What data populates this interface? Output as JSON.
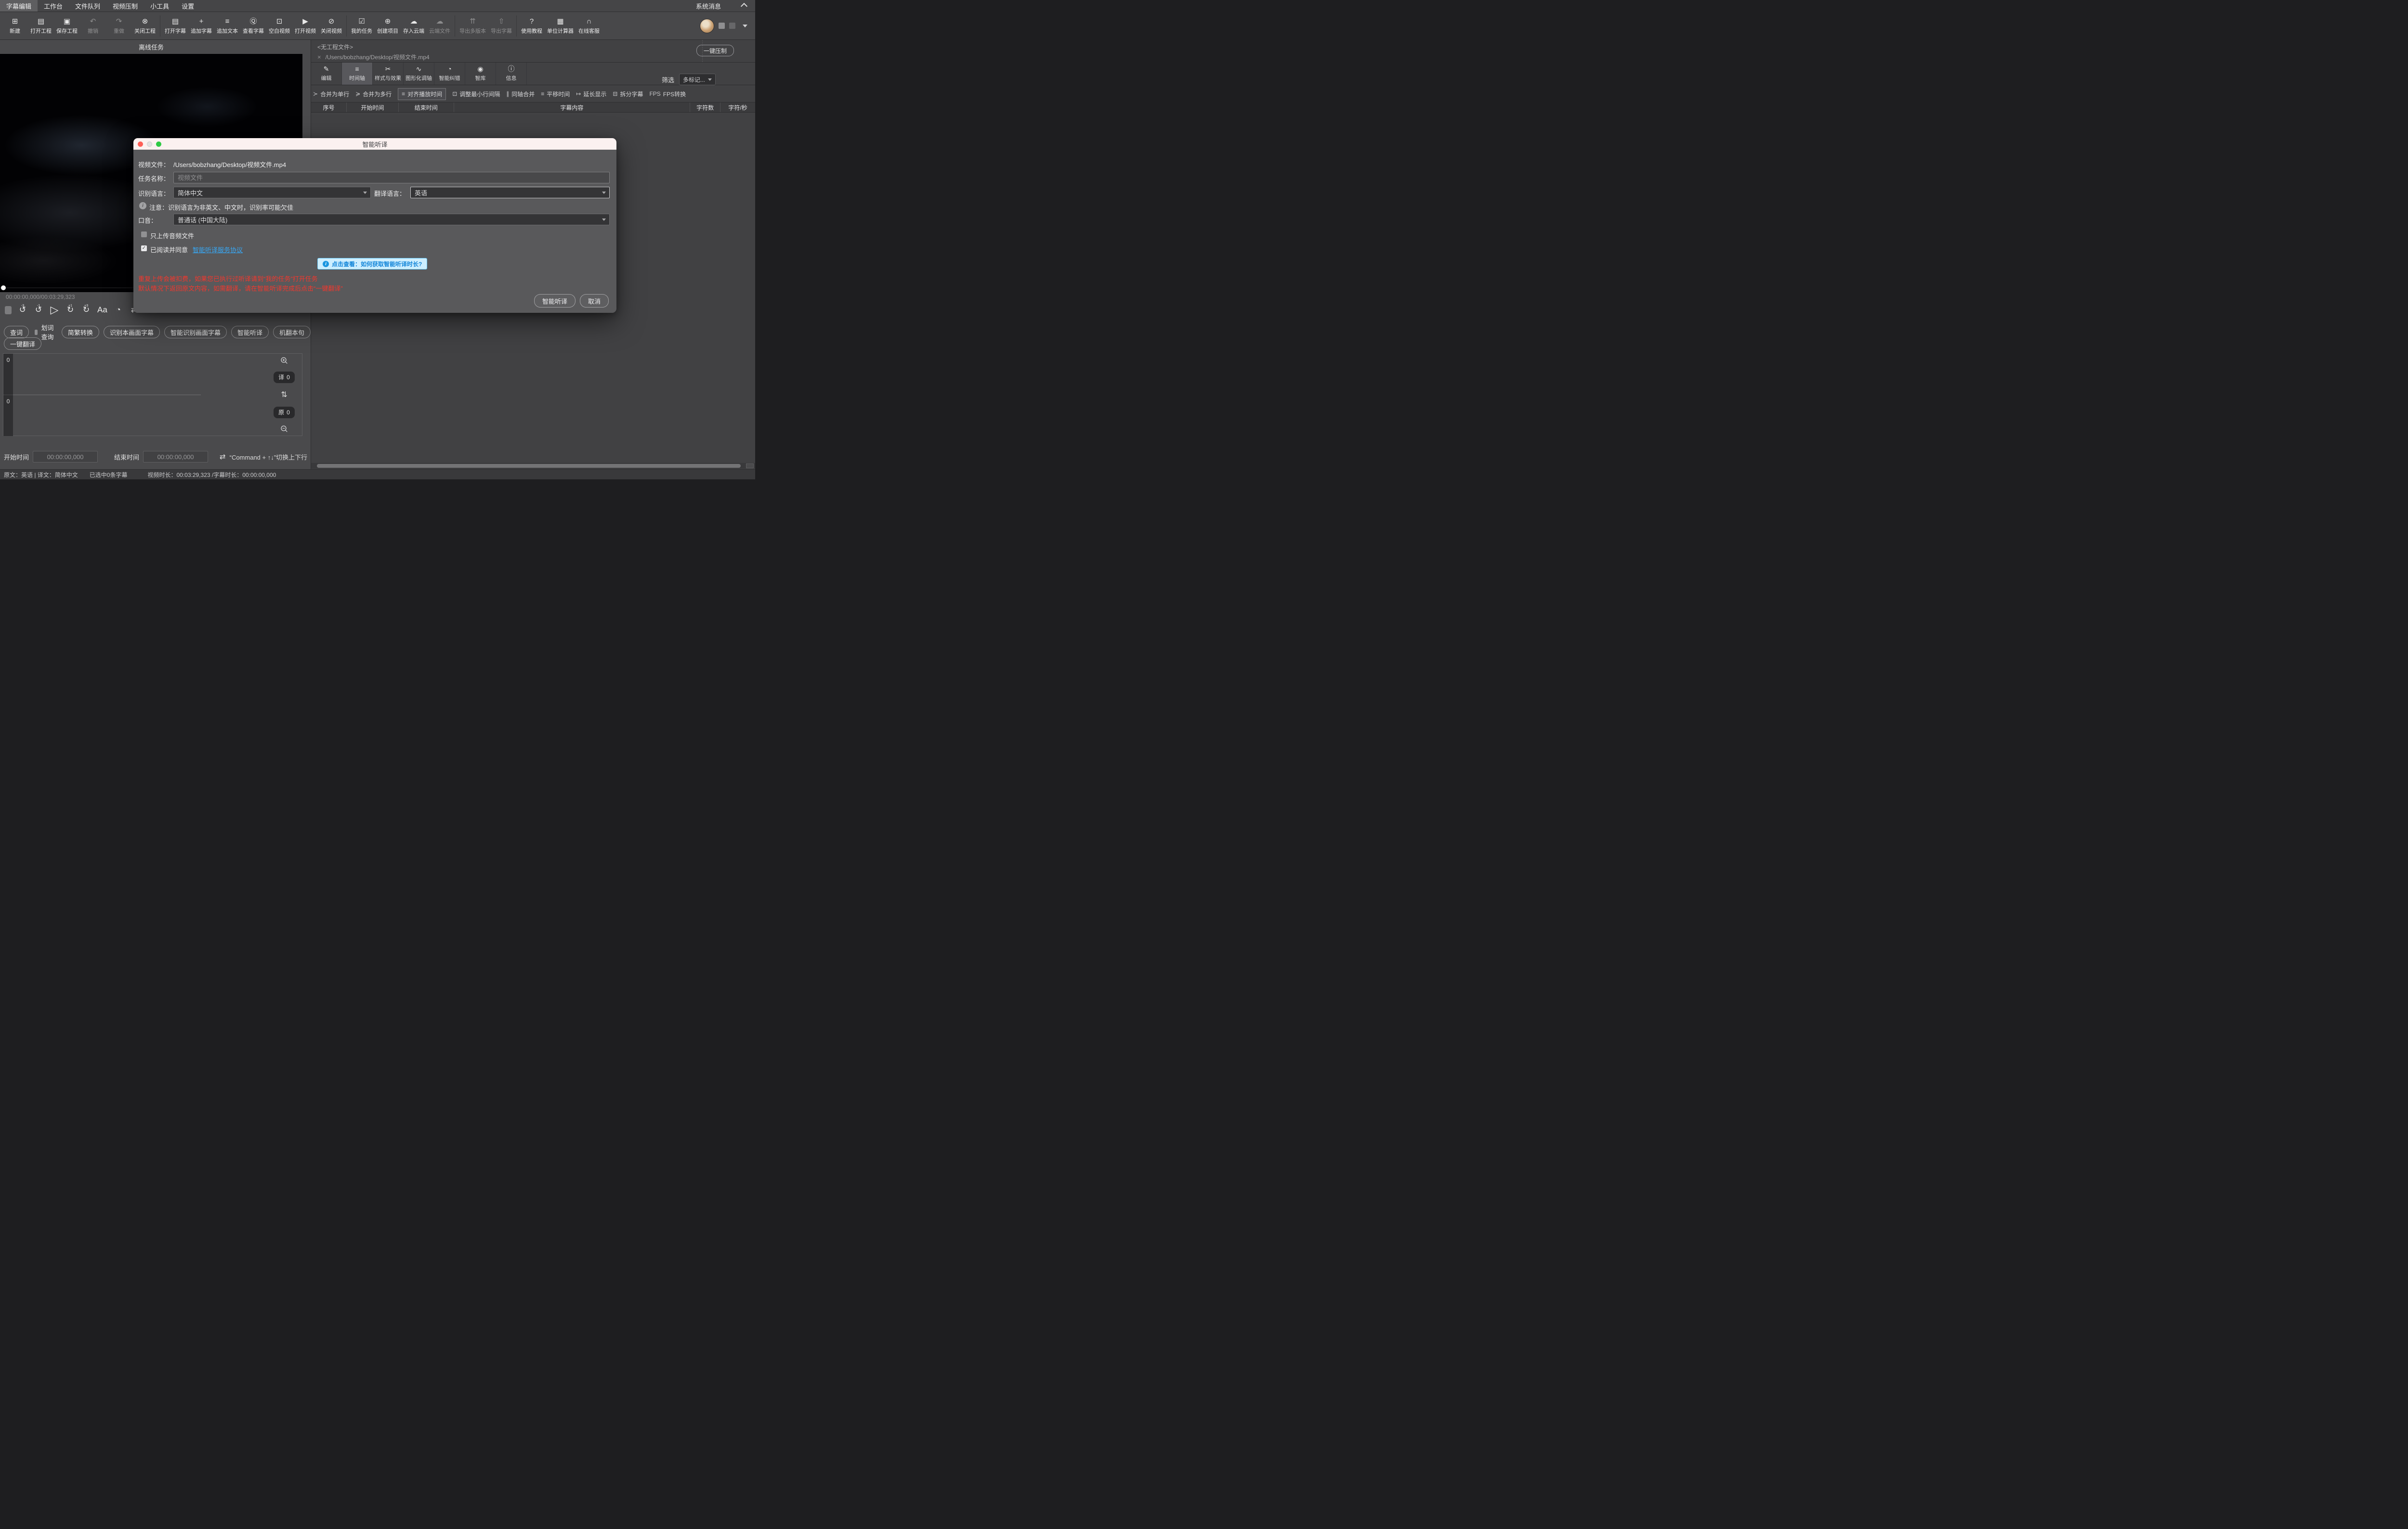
{
  "menu": {
    "items": [
      {
        "label": "字幕编辑"
      },
      {
        "label": "工作台"
      },
      {
        "label": "文件队列"
      },
      {
        "label": "视频压制"
      },
      {
        "label": "小工具"
      },
      {
        "label": "设置"
      }
    ],
    "system_message": "系统消息"
  },
  "toolbar": {
    "items": [
      {
        "icon": "⊞",
        "label": "新建"
      },
      {
        "icon": "▤",
        "label": "打开工程"
      },
      {
        "icon": "▣",
        "label": "保存工程"
      },
      {
        "icon": "↶",
        "label": "撤销"
      },
      {
        "icon": "↷",
        "label": "重做"
      },
      {
        "icon": "⊗",
        "label": "关闭工程"
      },
      {
        "icon": "▤",
        "label": "打开字幕"
      },
      {
        "icon": "+",
        "label": "追加字幕"
      },
      {
        "icon": "≡",
        "label": "追加文本"
      },
      {
        "icon": "Ⓠ",
        "label": "查看字幕"
      },
      {
        "icon": "⊡",
        "label": "空白视频"
      },
      {
        "icon": "▶",
        "label": "打开视频"
      },
      {
        "icon": "⊘",
        "label": "关闭视频"
      },
      {
        "icon": "☑",
        "label": "我的任务"
      },
      {
        "icon": "⊕",
        "label": "创建项目"
      },
      {
        "icon": "☁",
        "label": "存入云端"
      },
      {
        "icon": "☁",
        "label": "云端文件"
      },
      {
        "icon": "⇈",
        "label": "导出多版本"
      },
      {
        "icon": "⇧",
        "label": "导出字幕"
      },
      {
        "icon": "?",
        "label": "使用教程"
      },
      {
        "icon": "▦",
        "label": "单位计算器"
      },
      {
        "icon": "∩",
        "label": "在线客服"
      }
    ]
  },
  "left": {
    "header": "离线任务",
    "timestamp": "00:00:00,000/00:03:29,323",
    "controls": {
      "back_glyph": "↺",
      "fwd_glyph": "↻",
      "back3": "-3",
      "back1": "-1",
      "fwd1": "+1",
      "fwd3": "+3",
      "play": "▷",
      "font": "Aa",
      "clock": "◔",
      "extra1": "⇄",
      "extra2": "✂",
      "extra3": "≡",
      "extra4": "↦"
    },
    "actions1": [
      {
        "label": "查词"
      },
      {
        "label": "划词查询"
      },
      {
        "label": "简繁转换"
      },
      {
        "label": "识别本画面字幕"
      },
      {
        "label": "智能识别画面字幕"
      },
      {
        "label": "智能听译"
      },
      {
        "label": "机翻本句"
      }
    ],
    "actions2": [
      {
        "label": "一键翻译"
      }
    ],
    "editor": {
      "translated_lines": "0",
      "original_lines": "0",
      "trans_label": "译",
      "trans_count": "0",
      "orig_label": "原",
      "orig_count": "0",
      "swap_icon": "⇅"
    },
    "time": {
      "start_label": "开始时间",
      "start_value": "00:00:00,000",
      "end_label": "结束时间",
      "end_value": "00:00:00,000",
      "swap_icon": "⇄",
      "hint": "“Command + ↑↓”切换上下行"
    }
  },
  "right": {
    "project": "<无工程文件>",
    "file_close": "×",
    "file_path": "/Users/bobzhang/Desktop/视频文件.mp4",
    "compress": "一键压制",
    "tabs": [
      {
        "icon": "✎",
        "label": "编辑"
      },
      {
        "icon": "≡",
        "label": "时间轴"
      },
      {
        "icon": "✂",
        "label": "样式与效果"
      },
      {
        "icon": "∿",
        "label": "图形化调轴"
      },
      {
        "icon": "◔",
        "label": "智能纠错"
      },
      {
        "icon": "◉",
        "label": "智库"
      },
      {
        "icon": "ⓘ",
        "label": "信息"
      }
    ],
    "filter_label": "筛选",
    "filter_value": "多标记...",
    "actions": [
      {
        "icon": "≻",
        "label": "合并为单行"
      },
      {
        "icon": "≽",
        "label": "合并为多行"
      },
      {
        "icon": "≡",
        "label": "对齐播放时间"
      },
      {
        "icon": "⊡",
        "label": "调整最小行间隔"
      },
      {
        "icon": "∥",
        "label": "同轴合并"
      },
      {
        "icon": "≡",
        "label": "平移时间"
      },
      {
        "icon": "↦",
        "label": "延长显示"
      },
      {
        "icon": "⊟",
        "label": "拆分字幕"
      },
      {
        "icon": "FPS",
        "label": "FPS转换"
      }
    ],
    "table_headers": [
      "序号",
      "开始时间",
      "结束时间",
      "字幕内容",
      "字符数",
      "字符/秒"
    ]
  },
  "status": {
    "langs": "原文：英语 | 译文：简体中文",
    "selected": "已选中0条字幕",
    "durations": "视频时长：00:03:29,323 /字幕时长：00:00:00,000"
  },
  "dialog": {
    "title": "智能听译",
    "file_label": "视频文件：",
    "file_value": "/Users/bobzhang/Desktop/视频文件.mp4",
    "task_label": "任务名称：",
    "task_placeholder": "视频文件",
    "src_label": "识别语言：",
    "src_value": "简体中文",
    "tgt_label": "翻译语言：",
    "tgt_value": "英语",
    "notice": "注意：识别语言为非英文、中文时，识别率可能欠佳",
    "accent_label": "口音：",
    "accent_value": "普通话 (中国大陆)",
    "audio_only": "只上传音频文件",
    "agree_text": "已阅读并同意",
    "agree_link": "智能听译服务协议",
    "banner": "点击查看：如何获取智能听译时长?",
    "warn1": "重复上传会被扣费，如果您已执行过听译请到“我的任务”打开任务",
    "warn2": "默认情况下返回原文内容，如需翻译，请在智能听译完成后点击“一键翻译”",
    "ok": "智能听译",
    "cancel": "取消",
    "check": "✓",
    "info_glyph": "i"
  },
  "colors": {
    "accent_blue": "#38a7f3",
    "warning_red": "#f4372d",
    "banner_bg": "#cdeeff",
    "banner_border": "#66c4f5",
    "banner_text": "#1386d9",
    "dialog_titlebar": "#fbf1f0",
    "traffic_red": "#fe5f57",
    "traffic_green": "#2ec944",
    "panel_dark": "#414143",
    "panel_mid": "#4a4a4c"
  }
}
